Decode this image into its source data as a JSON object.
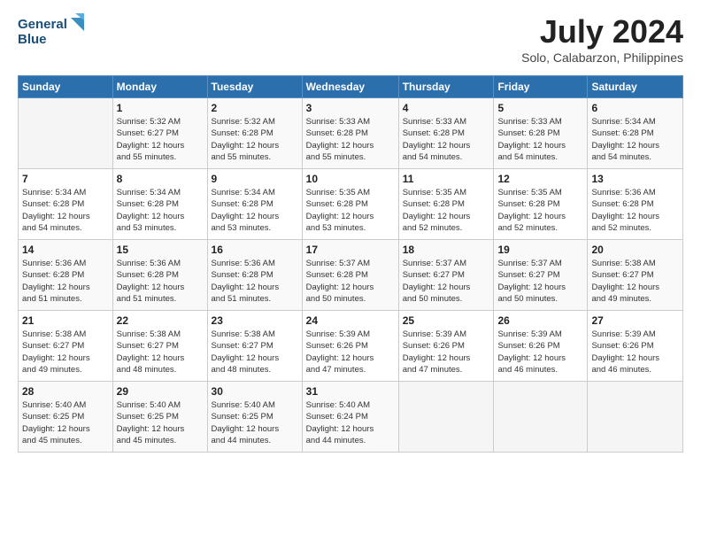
{
  "header": {
    "logo_line1": "General",
    "logo_line2": "Blue",
    "month_title": "July 2024",
    "subtitle": "Solo, Calabarzon, Philippines"
  },
  "weekdays": [
    "Sunday",
    "Monday",
    "Tuesday",
    "Wednesday",
    "Thursday",
    "Friday",
    "Saturday"
  ],
  "weeks": [
    [
      {
        "day": "",
        "info": ""
      },
      {
        "day": "1",
        "info": "Sunrise: 5:32 AM\nSunset: 6:27 PM\nDaylight: 12 hours\nand 55 minutes."
      },
      {
        "day": "2",
        "info": "Sunrise: 5:32 AM\nSunset: 6:28 PM\nDaylight: 12 hours\nand 55 minutes."
      },
      {
        "day": "3",
        "info": "Sunrise: 5:33 AM\nSunset: 6:28 PM\nDaylight: 12 hours\nand 55 minutes."
      },
      {
        "day": "4",
        "info": "Sunrise: 5:33 AM\nSunset: 6:28 PM\nDaylight: 12 hours\nand 54 minutes."
      },
      {
        "day": "5",
        "info": "Sunrise: 5:33 AM\nSunset: 6:28 PM\nDaylight: 12 hours\nand 54 minutes."
      },
      {
        "day": "6",
        "info": "Sunrise: 5:34 AM\nSunset: 6:28 PM\nDaylight: 12 hours\nand 54 minutes."
      }
    ],
    [
      {
        "day": "7",
        "info": "Sunrise: 5:34 AM\nSunset: 6:28 PM\nDaylight: 12 hours\nand 54 minutes."
      },
      {
        "day": "8",
        "info": "Sunrise: 5:34 AM\nSunset: 6:28 PM\nDaylight: 12 hours\nand 53 minutes."
      },
      {
        "day": "9",
        "info": "Sunrise: 5:34 AM\nSunset: 6:28 PM\nDaylight: 12 hours\nand 53 minutes."
      },
      {
        "day": "10",
        "info": "Sunrise: 5:35 AM\nSunset: 6:28 PM\nDaylight: 12 hours\nand 53 minutes."
      },
      {
        "day": "11",
        "info": "Sunrise: 5:35 AM\nSunset: 6:28 PM\nDaylight: 12 hours\nand 52 minutes."
      },
      {
        "day": "12",
        "info": "Sunrise: 5:35 AM\nSunset: 6:28 PM\nDaylight: 12 hours\nand 52 minutes."
      },
      {
        "day": "13",
        "info": "Sunrise: 5:36 AM\nSunset: 6:28 PM\nDaylight: 12 hours\nand 52 minutes."
      }
    ],
    [
      {
        "day": "14",
        "info": "Sunrise: 5:36 AM\nSunset: 6:28 PM\nDaylight: 12 hours\nand 51 minutes."
      },
      {
        "day": "15",
        "info": "Sunrise: 5:36 AM\nSunset: 6:28 PM\nDaylight: 12 hours\nand 51 minutes."
      },
      {
        "day": "16",
        "info": "Sunrise: 5:36 AM\nSunset: 6:28 PM\nDaylight: 12 hours\nand 51 minutes."
      },
      {
        "day": "17",
        "info": "Sunrise: 5:37 AM\nSunset: 6:28 PM\nDaylight: 12 hours\nand 50 minutes."
      },
      {
        "day": "18",
        "info": "Sunrise: 5:37 AM\nSunset: 6:27 PM\nDaylight: 12 hours\nand 50 minutes."
      },
      {
        "day": "19",
        "info": "Sunrise: 5:37 AM\nSunset: 6:27 PM\nDaylight: 12 hours\nand 50 minutes."
      },
      {
        "day": "20",
        "info": "Sunrise: 5:38 AM\nSunset: 6:27 PM\nDaylight: 12 hours\nand 49 minutes."
      }
    ],
    [
      {
        "day": "21",
        "info": "Sunrise: 5:38 AM\nSunset: 6:27 PM\nDaylight: 12 hours\nand 49 minutes."
      },
      {
        "day": "22",
        "info": "Sunrise: 5:38 AM\nSunset: 6:27 PM\nDaylight: 12 hours\nand 48 minutes."
      },
      {
        "day": "23",
        "info": "Sunrise: 5:38 AM\nSunset: 6:27 PM\nDaylight: 12 hours\nand 48 minutes."
      },
      {
        "day": "24",
        "info": "Sunrise: 5:39 AM\nSunset: 6:26 PM\nDaylight: 12 hours\nand 47 minutes."
      },
      {
        "day": "25",
        "info": "Sunrise: 5:39 AM\nSunset: 6:26 PM\nDaylight: 12 hours\nand 47 minutes."
      },
      {
        "day": "26",
        "info": "Sunrise: 5:39 AM\nSunset: 6:26 PM\nDaylight: 12 hours\nand 46 minutes."
      },
      {
        "day": "27",
        "info": "Sunrise: 5:39 AM\nSunset: 6:26 PM\nDaylight: 12 hours\nand 46 minutes."
      }
    ],
    [
      {
        "day": "28",
        "info": "Sunrise: 5:40 AM\nSunset: 6:25 PM\nDaylight: 12 hours\nand 45 minutes."
      },
      {
        "day": "29",
        "info": "Sunrise: 5:40 AM\nSunset: 6:25 PM\nDaylight: 12 hours\nand 45 minutes."
      },
      {
        "day": "30",
        "info": "Sunrise: 5:40 AM\nSunset: 6:25 PM\nDaylight: 12 hours\nand 44 minutes."
      },
      {
        "day": "31",
        "info": "Sunrise: 5:40 AM\nSunset: 6:24 PM\nDaylight: 12 hours\nand 44 minutes."
      },
      {
        "day": "",
        "info": ""
      },
      {
        "day": "",
        "info": ""
      },
      {
        "day": "",
        "info": ""
      }
    ]
  ]
}
